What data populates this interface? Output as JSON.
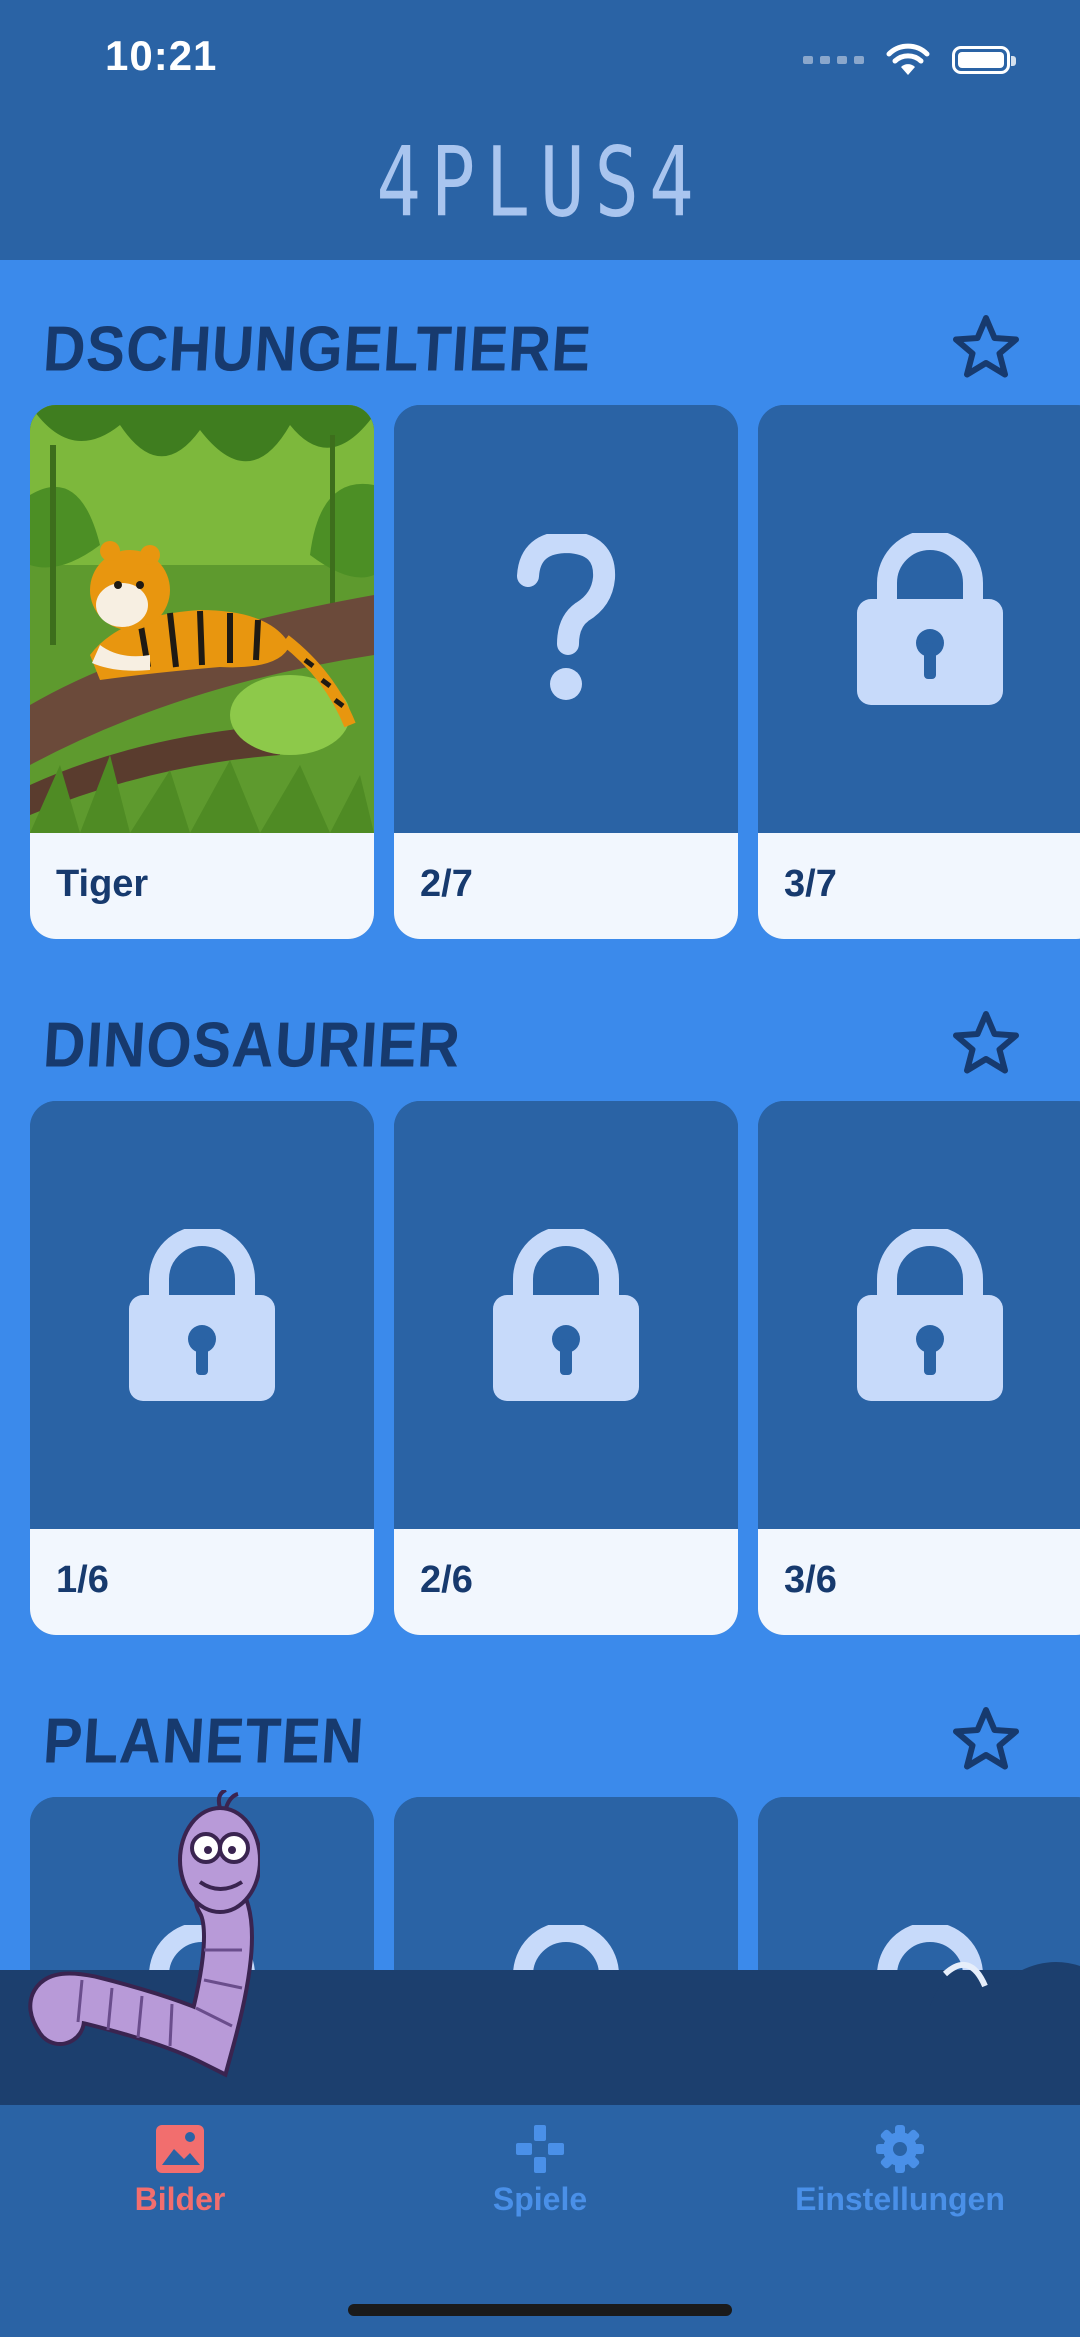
{
  "status_bar": {
    "time": "10:21"
  },
  "header": {
    "logo": "4PLUS4"
  },
  "sections": [
    {
      "title": "DSCHUNGELTIERE",
      "cards": [
        {
          "label": "Tiger",
          "state": "image",
          "icon": "tiger-image"
        },
        {
          "label": "2/7",
          "state": "unknown",
          "icon": "question-mark-icon"
        },
        {
          "label": "3/7",
          "state": "locked",
          "icon": "lock-icon"
        }
      ]
    },
    {
      "title": "DINOSAURIER",
      "cards": [
        {
          "label": "1/6",
          "state": "locked",
          "icon": "lock-icon"
        },
        {
          "label": "2/6",
          "state": "locked",
          "icon": "lock-icon"
        },
        {
          "label": "3/6",
          "state": "locked",
          "icon": "lock-icon"
        }
      ]
    },
    {
      "title": "PLANETEN",
      "cards": [
        {
          "state": "locked",
          "icon": "lock-icon"
        },
        {
          "state": "locked",
          "icon": "lock-icon"
        },
        {
          "state": "locked",
          "icon": "lock-icon"
        }
      ]
    }
  ],
  "tabbar": {
    "tabs": [
      {
        "label": "Bilder",
        "icon": "image-icon",
        "active": true
      },
      {
        "label": "Spiele",
        "icon": "gamepad-icon",
        "active": false
      },
      {
        "label": "Einstellungen",
        "icon": "gear-icon",
        "active": false
      }
    ]
  },
  "colors": {
    "background": "#3B8AEB",
    "header": "#2A63A5",
    "card": "#2A63A5",
    "card_label_bg": "#F2F7FE",
    "title": "#173A6E",
    "icon_light": "#C7DAFA",
    "active_tab": "#F26E6E",
    "inactive_tab": "#4A90E8"
  }
}
